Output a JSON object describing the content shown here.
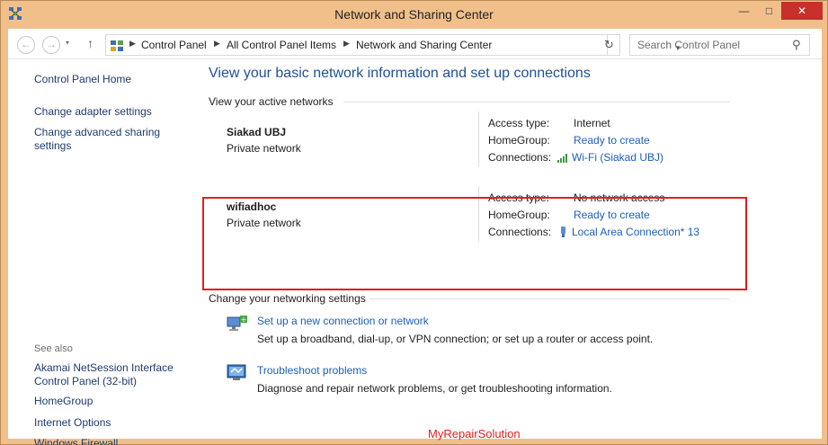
{
  "window": {
    "title": "Network and Sharing Center",
    "minimize_label": "—",
    "maximize_label": "□",
    "close_label": "✕"
  },
  "address": {
    "crumbs": [
      "Control Panel",
      "All Control Panel Items",
      "Network and Sharing Center"
    ],
    "search_placeholder": "Search Control Panel"
  },
  "sidebar": {
    "top_links": [
      "Control Panel Home",
      "Change adapter settings",
      "Change advanced sharing settings"
    ],
    "see_also_label": "See also",
    "see_also_links": [
      "Akamai NetSession Interface Control Panel (32-bit)",
      "HomeGroup",
      "Internet Options",
      "Windows Firewall"
    ]
  },
  "main": {
    "title": "View your basic network information and set up connections",
    "active_networks_label": "View your active networks",
    "networks": [
      {
        "name": "Siakad UBJ",
        "type": "Private network",
        "access_type_label": "Access type:",
        "access_type": "Internet",
        "homegroup_label": "HomeGroup:",
        "homegroup": "Ready to create",
        "connections_label": "Connections:",
        "connection": "Wi-Fi (Siakad UBJ)",
        "connection_icon": "wifi-signal-icon"
      },
      {
        "name": "wifiadhoc",
        "type": "Private network",
        "access_type_label": "Access type:",
        "access_type": "No network access",
        "homegroup_label": "HomeGroup:",
        "homegroup": "Ready to create",
        "connections_label": "Connections:",
        "connection": "Local Area Connection* 13",
        "connection_icon": "network-adapter-icon"
      }
    ],
    "change_settings_label": "Change your networking settings",
    "tasks": [
      {
        "link": "Set up a new connection or network",
        "description": "Set up a broadband, dial-up, or VPN connection; or set up a router or access point.",
        "icon": "new-connection-icon"
      },
      {
        "link": "Troubleshoot problems",
        "description": "Diagnose and repair network problems, or get troubleshooting information.",
        "icon": "troubleshoot-icon"
      }
    ]
  },
  "watermark": "MyRepairSolution",
  "colors": {
    "window_frame": "#f1c08a",
    "close_button": "#c7302b",
    "link": "#1e5fb4",
    "title": "#1e5297",
    "highlight": "#e01f1f"
  }
}
